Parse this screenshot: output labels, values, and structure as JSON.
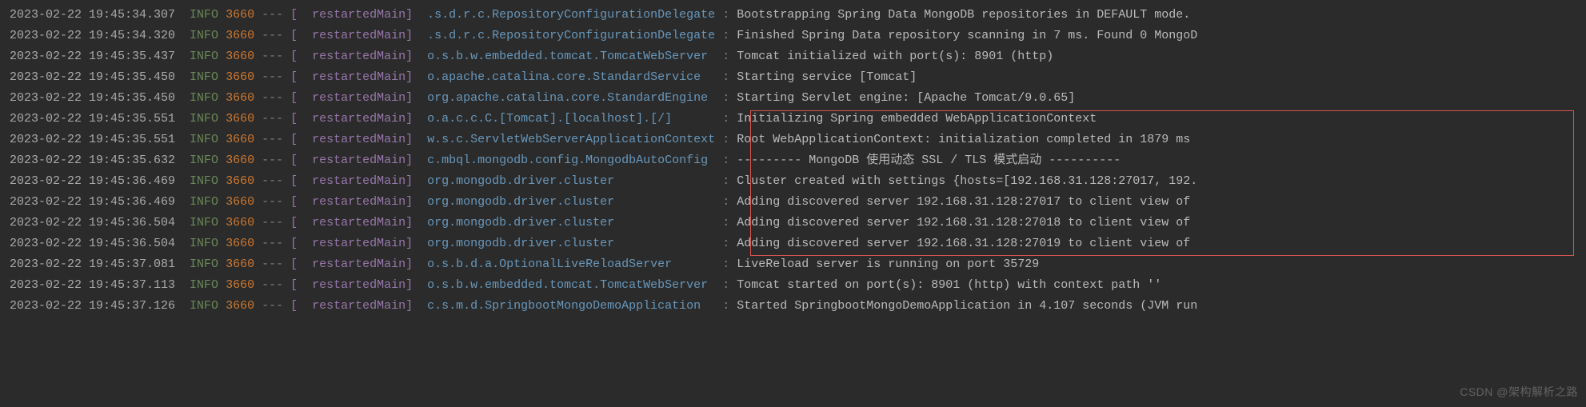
{
  "watermark": "CSDN @架构解析之路",
  "logs": [
    {
      "ts": "2023-02-22 19:45:34.307",
      "level": "INFO",
      "pid": "3660",
      "dash": "---",
      "thread": "[  restartedMain]",
      "logger": ".s.d.r.c.RepositoryConfigurationDelegate",
      "msg": "Bootstrapping Spring Data MongoDB repositories in DEFAULT mode."
    },
    {
      "ts": "2023-02-22 19:45:34.320",
      "level": "INFO",
      "pid": "3660",
      "dash": "---",
      "thread": "[  restartedMain]",
      "logger": ".s.d.r.c.RepositoryConfigurationDelegate",
      "msg": "Finished Spring Data repository scanning in 7 ms. Found 0 MongoD"
    },
    {
      "ts": "2023-02-22 19:45:35.437",
      "level": "INFO",
      "pid": "3660",
      "dash": "---",
      "thread": "[  restartedMain]",
      "logger": "o.s.b.w.embedded.tomcat.TomcatWebServer ",
      "msg": "Tomcat initialized with port(s): 8901 (http)"
    },
    {
      "ts": "2023-02-22 19:45:35.450",
      "level": "INFO",
      "pid": "3660",
      "dash": "---",
      "thread": "[  restartedMain]",
      "logger": "o.apache.catalina.core.StandardService  ",
      "msg": "Starting service [Tomcat]"
    },
    {
      "ts": "2023-02-22 19:45:35.450",
      "level": "INFO",
      "pid": "3660",
      "dash": "---",
      "thread": "[  restartedMain]",
      "logger": "org.apache.catalina.core.StandardEngine ",
      "msg": "Starting Servlet engine: [Apache Tomcat/9.0.65]"
    },
    {
      "ts": "2023-02-22 19:45:35.551",
      "level": "INFO",
      "pid": "3660",
      "dash": "---",
      "thread": "[  restartedMain]",
      "logger": "o.a.c.c.C.[Tomcat].[localhost].[/]      ",
      "msg": "Initializing Spring embedded WebApplicationContext"
    },
    {
      "ts": "2023-02-22 19:45:35.551",
      "level": "INFO",
      "pid": "3660",
      "dash": "---",
      "thread": "[  restartedMain]",
      "logger": "w.s.c.ServletWebServerApplicationContext",
      "msg": "Root WebApplicationContext: initialization completed in 1879 ms"
    },
    {
      "ts": "2023-02-22 19:45:35.632",
      "level": "INFO",
      "pid": "3660",
      "dash": "---",
      "thread": "[  restartedMain]",
      "logger": "c.mbql.mongodb.config.MongodbAutoConfig ",
      "msg": "--------- MongoDB 使用动态 SSL / TLS 模式启动 ----------"
    },
    {
      "ts": "2023-02-22 19:45:36.469",
      "level": "INFO",
      "pid": "3660",
      "dash": "---",
      "thread": "[  restartedMain]",
      "logger": "org.mongodb.driver.cluster              ",
      "msg": "Cluster created with settings {hosts=[192.168.31.128:27017, 192."
    },
    {
      "ts": "2023-02-22 19:45:36.469",
      "level": "INFO",
      "pid": "3660",
      "dash": "---",
      "thread": "[  restartedMain]",
      "logger": "org.mongodb.driver.cluster              ",
      "msg": "Adding discovered server 192.168.31.128:27017 to client view of"
    },
    {
      "ts": "2023-02-22 19:45:36.504",
      "level": "INFO",
      "pid": "3660",
      "dash": "---",
      "thread": "[  restartedMain]",
      "logger": "org.mongodb.driver.cluster              ",
      "msg": "Adding discovered server 192.168.31.128:27018 to client view of"
    },
    {
      "ts": "2023-02-22 19:45:36.504",
      "level": "INFO",
      "pid": "3660",
      "dash": "---",
      "thread": "[  restartedMain]",
      "logger": "org.mongodb.driver.cluster              ",
      "msg": "Adding discovered server 192.168.31.128:27019 to client view of"
    },
    {
      "ts": "2023-02-22 19:45:37.081",
      "level": "INFO",
      "pid": "3660",
      "dash": "---",
      "thread": "[  restartedMain]",
      "logger": "o.s.b.d.a.OptionalLiveReloadServer      ",
      "msg": "LiveReload server is running on port 35729"
    },
    {
      "ts": "2023-02-22 19:45:37.113",
      "level": "INFO",
      "pid": "3660",
      "dash": "---",
      "thread": "[  restartedMain]",
      "logger": "o.s.b.w.embedded.tomcat.TomcatWebServer ",
      "msg": "Tomcat started on port(s): 8901 (http) with context path ''"
    },
    {
      "ts": "2023-02-22 19:45:37.126",
      "level": "INFO",
      "pid": "3660",
      "dash": "---",
      "thread": "[  restartedMain]",
      "logger": "c.s.m.d.SpringbootMongoDemoApplication  ",
      "msg": "Started SpringbootMongoDemoApplication in 4.107 seconds (JVM run"
    }
  ]
}
